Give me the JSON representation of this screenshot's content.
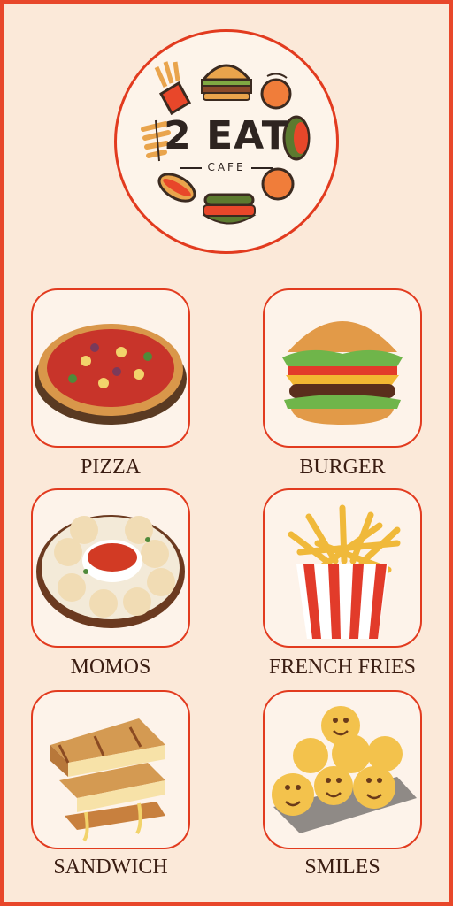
{
  "logo": {
    "title": "2 EAT",
    "subtitle": "CAFE"
  },
  "menu": {
    "items": [
      {
        "label": "PIZZA"
      },
      {
        "label": "BURGER"
      },
      {
        "label": "MOMOS"
      },
      {
        "label": "FRENCH FRIES"
      },
      {
        "label": "SANDWICH"
      },
      {
        "label": "SMILES"
      }
    ]
  },
  "colors": {
    "frame": "#e8472a",
    "background": "#fbe9d9",
    "card_border": "#e23b1f",
    "label_text": "#3a1d12"
  }
}
